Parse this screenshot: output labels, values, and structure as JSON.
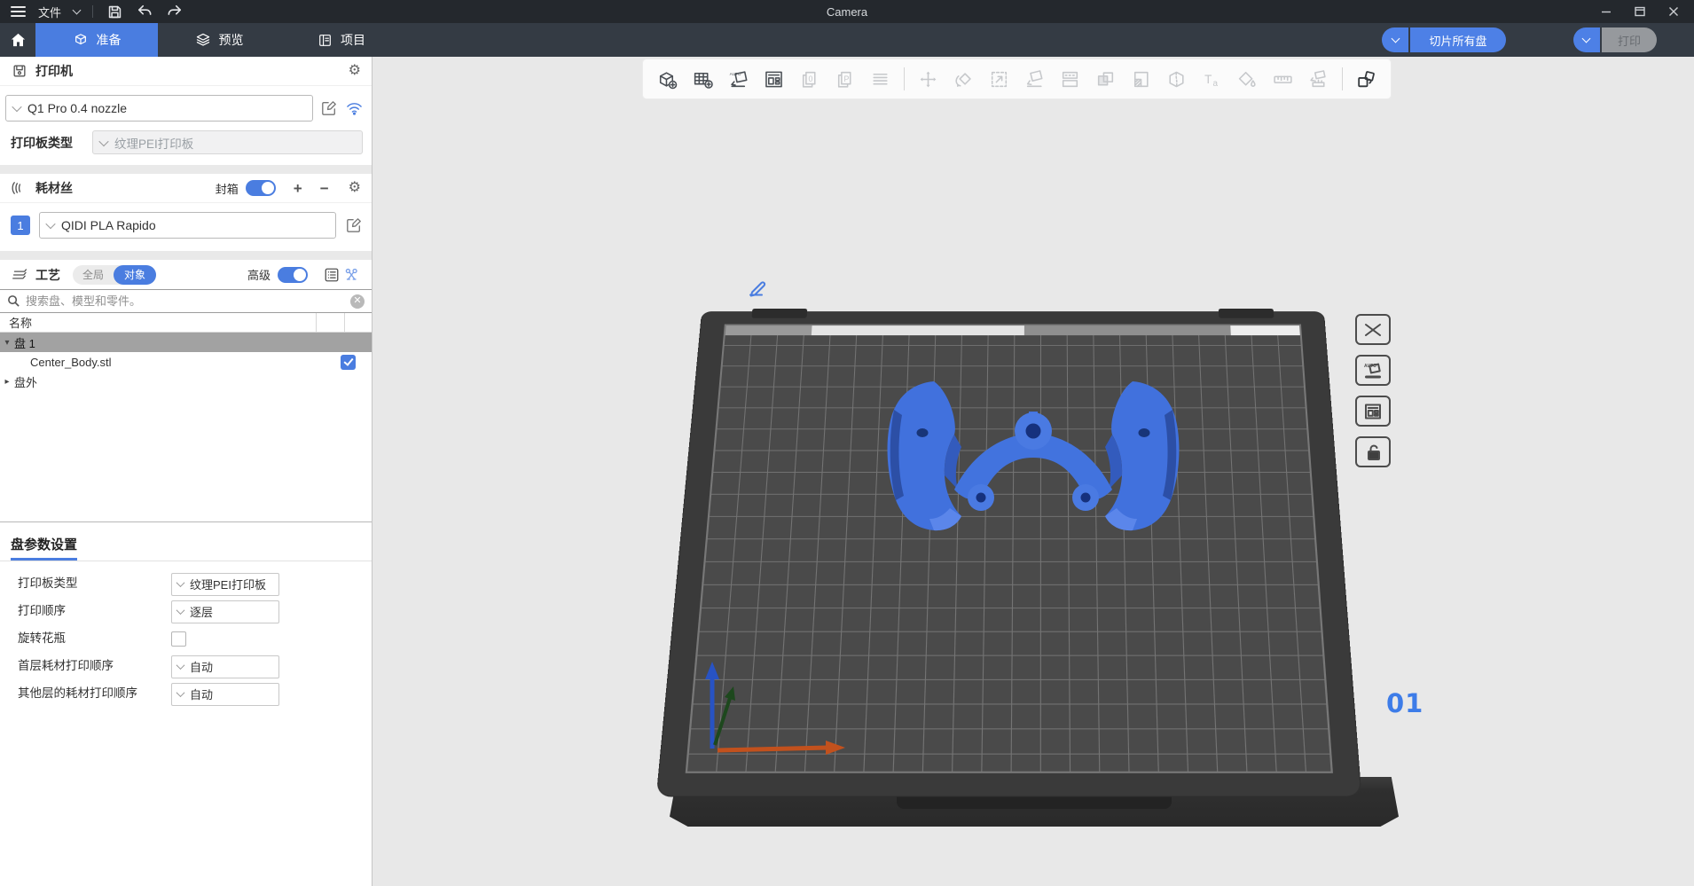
{
  "titlebar": {
    "menu": "文件",
    "title": "Camera"
  },
  "tabs": {
    "prepare": "准备",
    "preview": "预览",
    "project": "项目"
  },
  "topbar": {
    "slice": "切片所有盘",
    "print": "打印"
  },
  "printer": {
    "title": "打印机",
    "preset": "Q1 Pro 0.4 nozzle",
    "bed_label": "打印板类型",
    "bed_value": "纹理PEI打印板"
  },
  "filament": {
    "title": "耗材丝",
    "box_label": "封箱",
    "slot": "1",
    "preset": "QIDI PLA Rapido"
  },
  "process": {
    "title": "工艺",
    "scope_global": "全局",
    "scope_object": "对象",
    "advanced": "高级",
    "search_placeholder": "搜索盘、模型和零件。"
  },
  "tree": {
    "header": "名称",
    "plate_row": "盘 1",
    "model_row": "Center_Body.stl",
    "outside_row": "盘外"
  },
  "plate_settings": {
    "title": "盘参数设置",
    "bed_label": "打印板类型",
    "bed_value": "纹理PEI打印板",
    "order_label": "打印顺序",
    "order_value": "逐层",
    "vase_label": "旋转花瓶",
    "vase_checked": false,
    "first_layer_label": "首层耗材打印顺序",
    "first_layer_value": "自动",
    "other_layers_label": "其他层的耗材打印顺序",
    "other_layers_value": "自动"
  },
  "viewport": {
    "plate_number": "01"
  },
  "toolbar_icons": [
    "add-model",
    "add-plate",
    "auto-orient",
    "arrange",
    "copy",
    "paste",
    "layers-list",
    "move",
    "rotate",
    "scale",
    "lay-on-face",
    "split-plate",
    "merge",
    "split-parts",
    "cut",
    "text",
    "paint",
    "measure",
    "support-paint",
    "assembly"
  ],
  "plate_tool_icons": [
    "delete-plate",
    "auto-orient-plate",
    "arrange-plate",
    "lock-plate"
  ],
  "titlebar_icons": [
    "menu-icon",
    "chevron-down-icon",
    "save-icon",
    "undo-icon",
    "redo-icon",
    "minimize-icon",
    "maximize-icon",
    "close-icon"
  ],
  "panel_icons": [
    "printer-icon",
    "gear-icon",
    "edit-icon",
    "wifi-icon",
    "filament-spool-icon",
    "plus-icon",
    "minus-icon",
    "process-icon",
    "parameter-table-icon",
    "process-settings-icon",
    "search-icon",
    "clear-icon",
    "checkbox-checked-icon"
  ],
  "colors": {
    "accent": "#4a7de0",
    "model_blue": "#4171dd",
    "titlebar_bg": "#24282d",
    "tabbar_bg": "#343b44",
    "viewport_bg": "#e8e8e8",
    "plate_surface": "#4a4a4a"
  }
}
